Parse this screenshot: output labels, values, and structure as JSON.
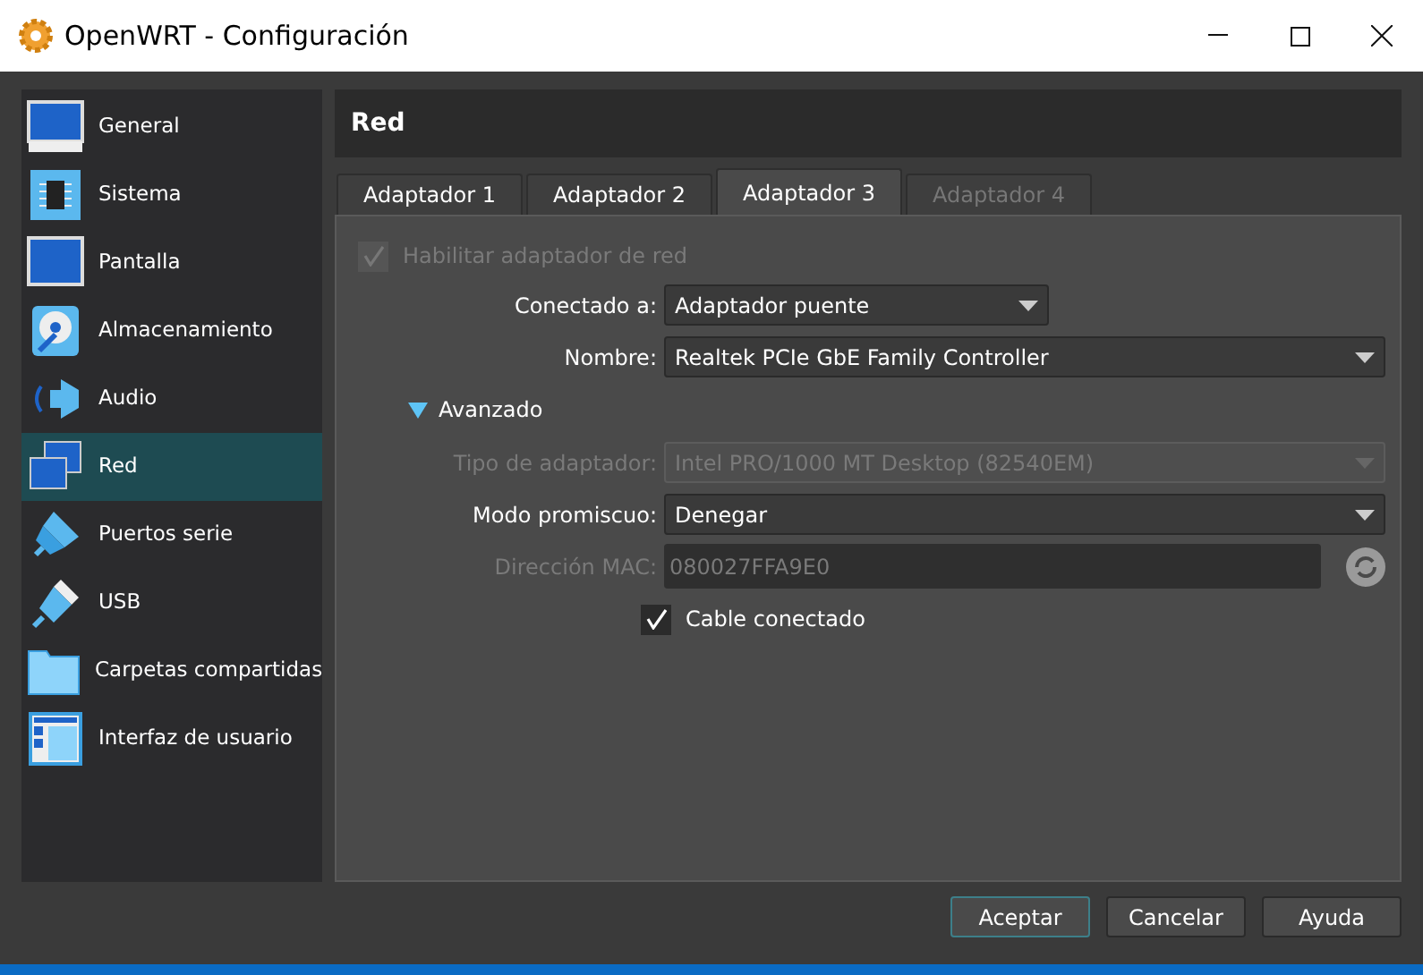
{
  "window": {
    "title": "OpenWRT - Configuración"
  },
  "sidebar": {
    "items": [
      {
        "label": "General",
        "selected": false
      },
      {
        "label": "Sistema",
        "selected": false
      },
      {
        "label": "Pantalla",
        "selected": false
      },
      {
        "label": "Almacenamiento",
        "selected": false
      },
      {
        "label": "Audio",
        "selected": false
      },
      {
        "label": "Red",
        "selected": true
      },
      {
        "label": "Puertos serie",
        "selected": false
      },
      {
        "label": "USB",
        "selected": false
      },
      {
        "label": "Carpetas compartidas",
        "selected": false
      },
      {
        "label": "Interfaz de usuario",
        "selected": false
      }
    ]
  },
  "section_title": "Red",
  "tabs": [
    {
      "label": "Adaptador 1",
      "selected": false,
      "disabled": false
    },
    {
      "label": "Adaptador 2",
      "selected": false,
      "disabled": false
    },
    {
      "label": "Adaptador 3",
      "selected": true,
      "disabled": false
    },
    {
      "label": "Adaptador 4",
      "selected": false,
      "disabled": true
    }
  ],
  "enable_adapter": {
    "label": "Habilitar adaptador de red",
    "checked": true,
    "disabled": true
  },
  "fields": [
    {
      "kind": "dropdown",
      "label": "Conectado a:",
      "value": "Adaptador puente",
      "disabled": false,
      "narrow": true
    },
    {
      "kind": "dropdown",
      "label": "Nombre:",
      "value": "Realtek PCIe GbE Family Controller",
      "disabled": false
    }
  ],
  "advanced": {
    "label": "Avanzado",
    "expanded": true,
    "fields": [
      {
        "kind": "dropdown",
        "label": "Tipo de adaptador:",
        "value": "Intel PRO/1000 MT Desktop (82540EM)",
        "disabled": true
      },
      {
        "kind": "dropdown",
        "label": "Modo promiscuo:",
        "value": "Denegar",
        "disabled": false
      },
      {
        "kind": "text",
        "label": "Dirección MAC:",
        "value": "080027FFA9E0",
        "disabled": true
      }
    ],
    "cable": {
      "label": "Cable conectado",
      "checked": true,
      "disabled": false
    }
  },
  "buttons": [
    {
      "label": "Aceptar",
      "default": true
    },
    {
      "label": "Cancelar",
      "default": false
    },
    {
      "label": "Ayuda",
      "default": false
    }
  ]
}
